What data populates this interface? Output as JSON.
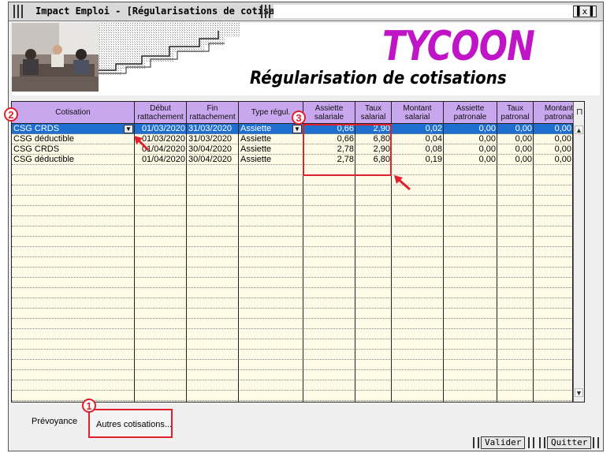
{
  "window": {
    "title": "Impact Emploi - [Régularisations de cotisations]",
    "close_label": "▌x▐"
  },
  "header": {
    "brand": "TYCOON",
    "subtitle": "Régularisation de cotisations"
  },
  "grid": {
    "columns": [
      {
        "label": "Cotisation"
      },
      {
        "label": "Début rattachement"
      },
      {
        "label": "Fin rattachement"
      },
      {
        "label": "Type régul."
      },
      {
        "label": "Assiette salariale"
      },
      {
        "label": "Taux salarial"
      },
      {
        "label": "Montant salarial"
      },
      {
        "label": "Assiette patronale"
      },
      {
        "label": "Taux patronal"
      },
      {
        "label": "Montant patronal"
      }
    ],
    "rows": [
      [
        "CSG CRDS",
        "01/03/2020",
        "31/03/2020",
        "Assiette",
        "0,66",
        "2,90",
        "0,02",
        "0,00",
        "0,00",
        "0,00"
      ],
      [
        "CSG déductible",
        "01/03/2020",
        "31/03/2020",
        "Assiette",
        "0,66",
        "6,80",
        "0,04",
        "0,00",
        "0,00",
        "0,00"
      ],
      [
        "CSG CRDS",
        "01/04/2020",
        "30/04/2020",
        "Assiette",
        "2,78",
        "2,90",
        "0,08",
        "0,00",
        "0,00",
        "0,00"
      ],
      [
        "CSG déductible",
        "01/04/2020",
        "30/04/2020",
        "Assiette",
        "2,78",
        "6,80",
        "0,19",
        "0,00",
        "0,00",
        "0,00"
      ]
    ],
    "selected_row": 0
  },
  "annotations": {
    "badge_1": "1",
    "badge_2": "2",
    "badge_3": "3",
    "highlight_color": "#e0202a"
  },
  "tabs": {
    "prevoyance": "Prévoyance",
    "autres": "Autres cotisations..."
  },
  "buttons": {
    "valider": "Valider",
    "quitter": "Quitter"
  },
  "colors": {
    "header_purple": "#c9a7ef",
    "row_yellow": "#fffbe6",
    "selection_blue": "#1f6fd1",
    "brand_magenta": "#c014c7"
  }
}
